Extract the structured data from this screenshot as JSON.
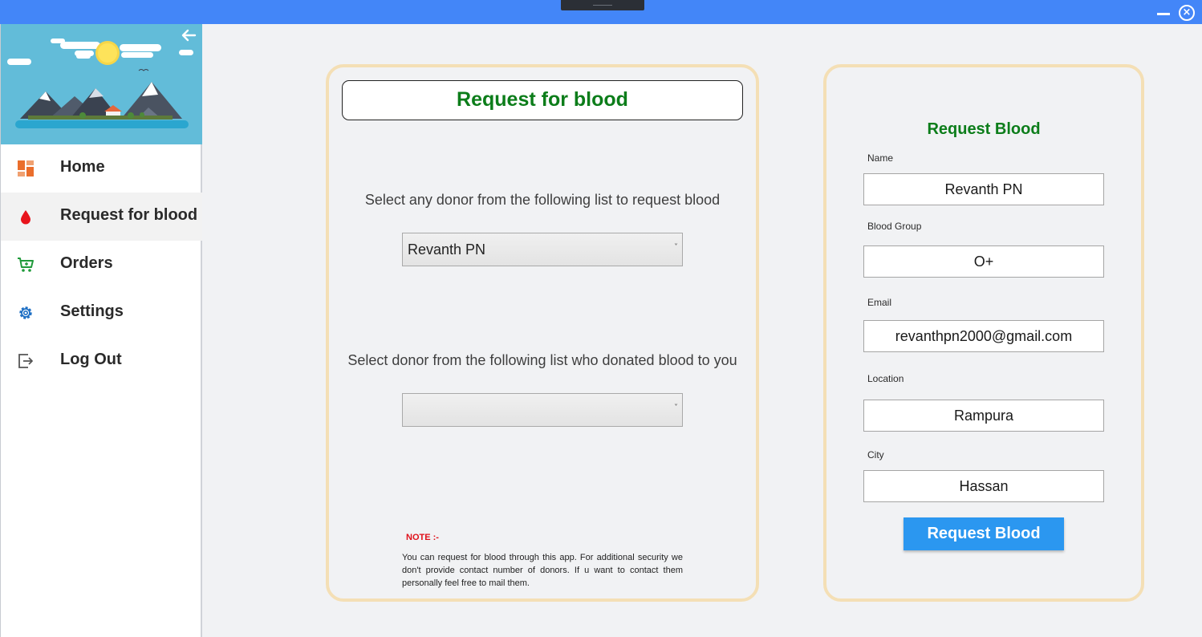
{
  "sidebar": {
    "items": [
      {
        "label": "Home",
        "icon": "dashboard-icon"
      },
      {
        "label": "Request for blood",
        "icon": "blood-drop-icon"
      },
      {
        "label": "Orders",
        "icon": "cart-icon"
      },
      {
        "label": "Settings",
        "icon": "gear-icon"
      },
      {
        "label": "Log Out",
        "icon": "logout-icon"
      }
    ],
    "active_index": 1
  },
  "request_panel": {
    "title": "Request for blood",
    "prompt_request": "Select any donor from the following list to request blood",
    "donor_select_value": "Revanth PN",
    "prompt_donated": "Select donor from the following list who donated blood to you",
    "donated_select_value": "",
    "note_heading": "NOTE :-",
    "note_text": "You can request for blood through this app. For additional security we don't provide contact number of donors. If u want to contact them personally feel free to mail them."
  },
  "request_form": {
    "title": "Request Blood",
    "name_label": "Name",
    "name_value": "Revanth PN",
    "blood_group_label": "Blood Group",
    "blood_group_value": "O+",
    "email_label": "Email",
    "email_value": "revanthpn2000@gmail.com",
    "location_label": "Location",
    "location_value": "Rampura",
    "city_label": "City",
    "city_value": "Hassan",
    "submit_label": "Request Blood"
  },
  "colors": {
    "titlebar": "#4386f8",
    "accent_green": "#0c7d1a",
    "card_border": "#f4dfb5",
    "button_blue": "#2b97f0",
    "note_red": "#e0101a"
  }
}
